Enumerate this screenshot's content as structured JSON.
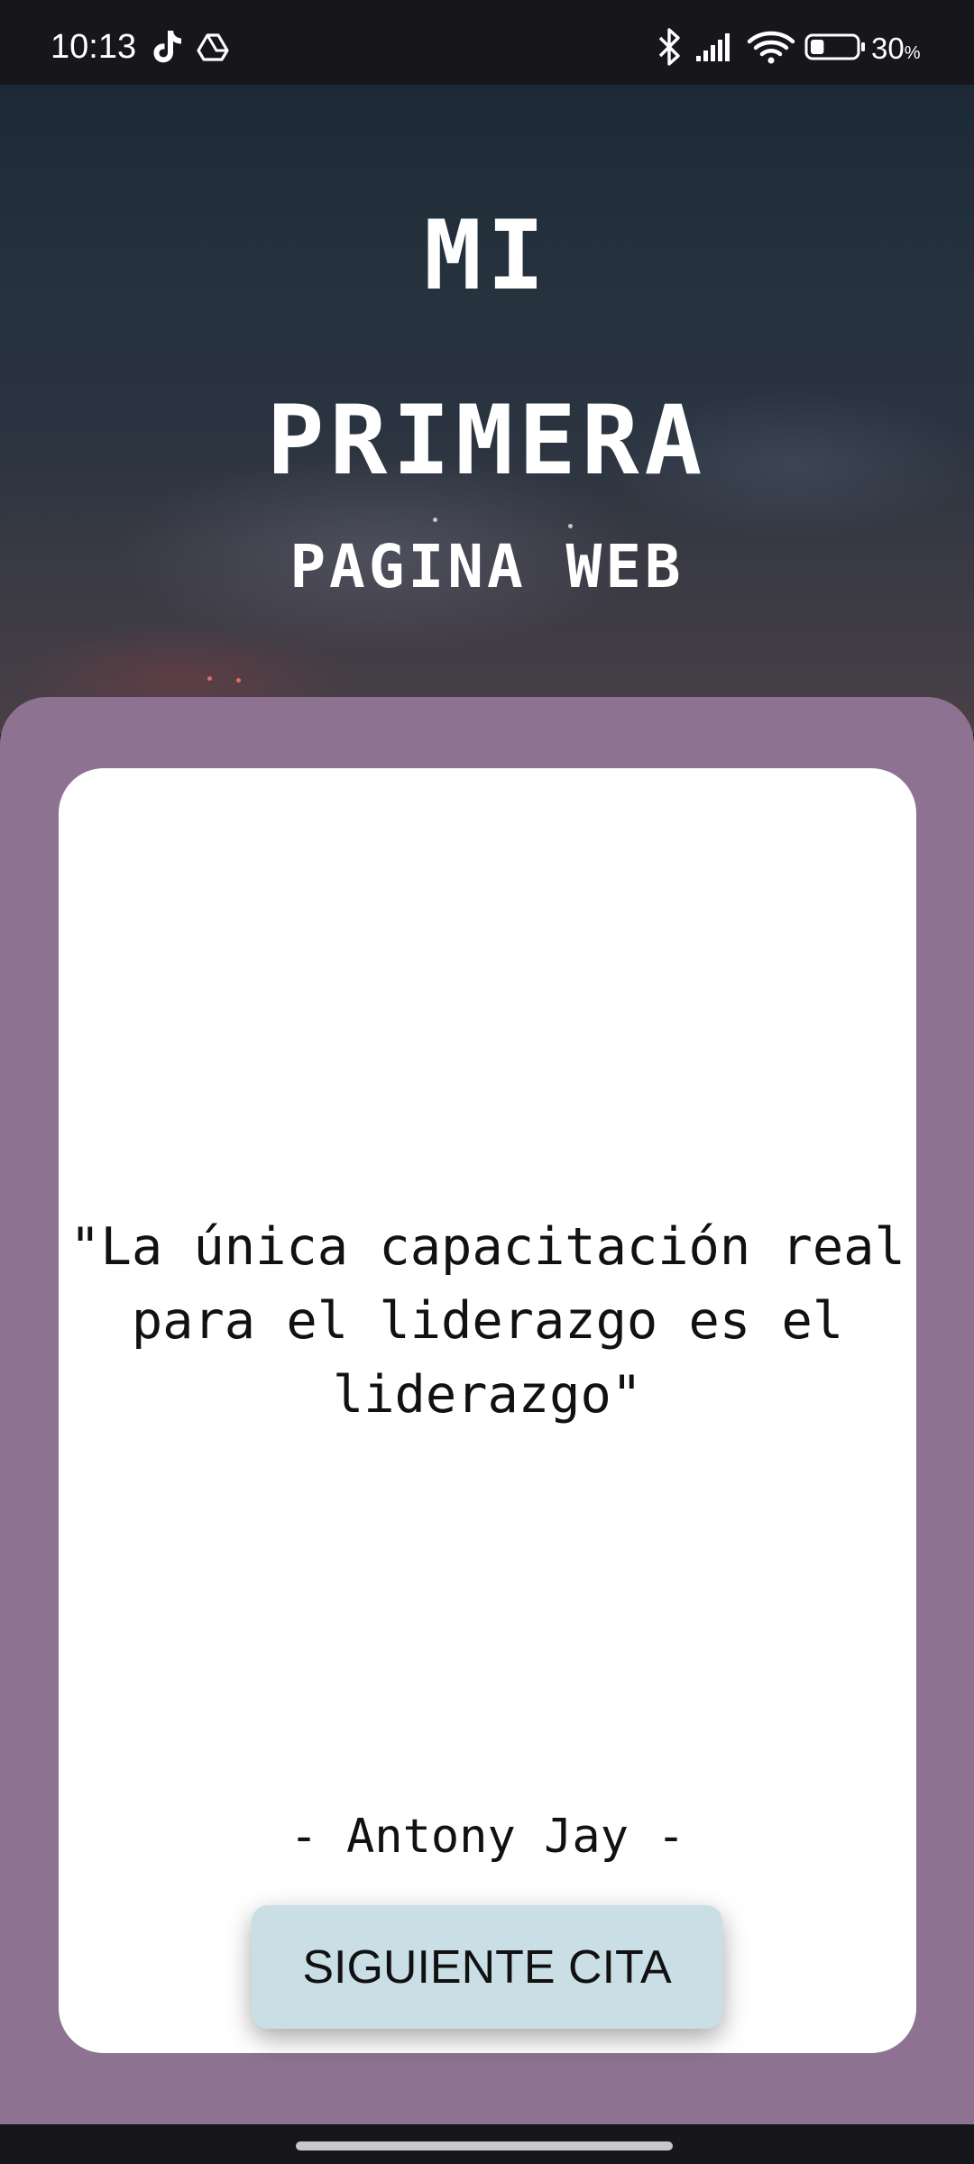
{
  "status_bar": {
    "time": "10:13",
    "battery_percent": "30",
    "battery_unit": "%",
    "battery_level": 0.3,
    "icons": [
      "tiktok-icon",
      "drive-icon",
      "bluetooth-icon",
      "signal-icon",
      "wifi-icon",
      "battery-icon"
    ]
  },
  "hero": {
    "title_line1": "MI",
    "title_line2": "PRIMERA",
    "title_line3": "PAGINA WEB"
  },
  "card": {
    "quote": "\"La única capacitación real para el liderazgo es el liderazgo\"",
    "author": "- Antony Jay -",
    "button_label": "SIGUIENTE CITA"
  },
  "colors": {
    "panel": "#8d7292",
    "card": "#ffffff",
    "button": "#c9dee5",
    "status_bar": "#16161b"
  }
}
